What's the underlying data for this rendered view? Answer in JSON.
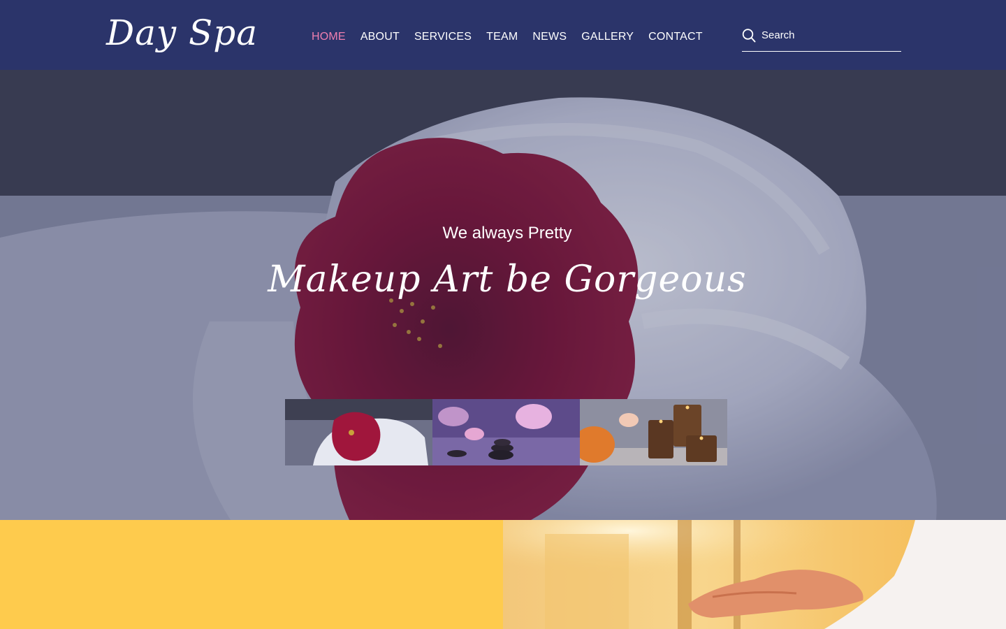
{
  "header": {
    "logo": "Day Spa",
    "nav": [
      {
        "label": "HOME",
        "active": true
      },
      {
        "label": "ABOUT",
        "active": false
      },
      {
        "label": "SERVICES",
        "active": false
      },
      {
        "label": "TEAM",
        "active": false
      },
      {
        "label": "NEWS",
        "active": false
      },
      {
        "label": "GALLERY",
        "active": false
      },
      {
        "label": "CONTACT",
        "active": false
      }
    ],
    "search": {
      "placeholder": "Search",
      "value": "",
      "icon": "search-icon"
    }
  },
  "hero": {
    "subtitle": "We always Pretty",
    "title": "Makeup Art be Gorgeous",
    "thumbnails": [
      "towel-flower-thumb",
      "orchid-stones-thumb",
      "candles-thumb"
    ]
  },
  "colors": {
    "header_bg": "#2b346a",
    "nav_active": "#ef7fb0",
    "accent_yellow": "#fecb4d"
  }
}
